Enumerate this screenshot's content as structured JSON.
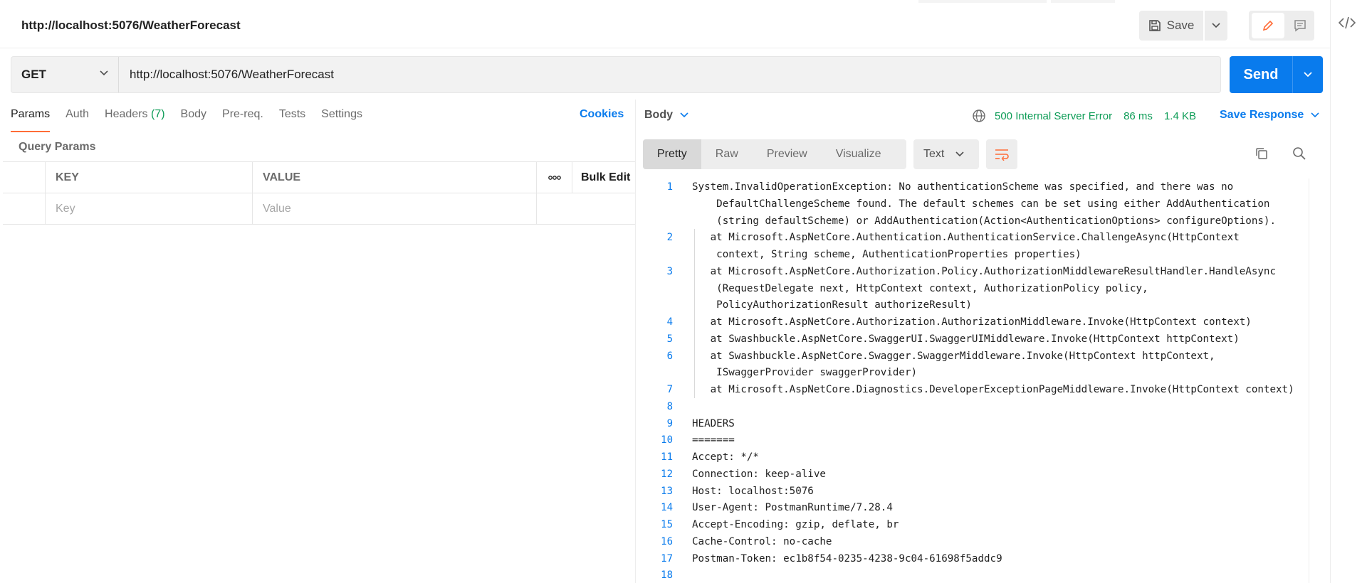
{
  "request": {
    "title": "http://localhost:5076/WeatherForecast",
    "method": "GET",
    "url": "http://localhost:5076/WeatherForecast",
    "save_label": "Save",
    "send_label": "Send"
  },
  "request_tabs": [
    {
      "label": "Params",
      "active": true
    },
    {
      "label": "Auth"
    },
    {
      "label": "Headers",
      "count": "(7)"
    },
    {
      "label": "Body"
    },
    {
      "label": "Pre-req."
    },
    {
      "label": "Tests"
    },
    {
      "label": "Settings"
    }
  ],
  "cookies_label": "Cookies",
  "query_params": {
    "label": "Query Params",
    "key_header": "KEY",
    "value_header": "VALUE",
    "more_label": "ooo",
    "bulk_edit_label": "Bulk Edit",
    "key_placeholder": "Key",
    "value_placeholder": "Value"
  },
  "response": {
    "body_label": "Body",
    "status": "500 Internal Server Error",
    "time": "86 ms",
    "size": "1.4 KB",
    "save_response_label": "Save Response",
    "view_tabs": [
      "Pretty",
      "Raw",
      "Preview",
      "Visualize"
    ],
    "active_view": "Pretty",
    "format": "Text"
  },
  "code_lines": [
    {
      "n": "1",
      "parts": [
        "System.InvalidOperationException: No authenticationScheme was specified, and there was no",
        "    DefaultChallengeScheme found. The default schemes can be set using either AddAuthentication",
        "    (string defaultScheme) or AddAuthentication(Action<AuthenticationOptions> configureOptions)."
      ]
    },
    {
      "n": "2",
      "parts": [
        "   at Microsoft.AspNetCore.Authentication.AuthenticationService.ChallengeAsync(HttpContext",
        "    context, String scheme, AuthenticationProperties properties)"
      ]
    },
    {
      "n": "3",
      "parts": [
        "   at Microsoft.AspNetCore.Authorization.Policy.AuthorizationMiddlewareResultHandler.HandleAsync",
        "    (RequestDelegate next, HttpContext context, AuthorizationPolicy policy,",
        "    PolicyAuthorizationResult authorizeResult)"
      ]
    },
    {
      "n": "4",
      "parts": [
        "   at Microsoft.AspNetCore.Authorization.AuthorizationMiddleware.Invoke(HttpContext context)"
      ]
    },
    {
      "n": "5",
      "parts": [
        "   at Swashbuckle.AspNetCore.SwaggerUI.SwaggerUIMiddleware.Invoke(HttpContext httpContext)"
      ]
    },
    {
      "n": "6",
      "parts": [
        "   at Swashbuckle.AspNetCore.Swagger.SwaggerMiddleware.Invoke(HttpContext httpContext,",
        "    ISwaggerProvider swaggerProvider)"
      ]
    },
    {
      "n": "7",
      "parts": [
        "   at Microsoft.AspNetCore.Diagnostics.DeveloperExceptionPageMiddleware.Invoke(HttpContext context)"
      ]
    },
    {
      "n": "8",
      "parts": [
        ""
      ]
    },
    {
      "n": "9",
      "parts": [
        "HEADERS"
      ]
    },
    {
      "n": "10",
      "parts": [
        "======="
      ]
    },
    {
      "n": "11",
      "parts": [
        "Accept: */*"
      ]
    },
    {
      "n": "12",
      "parts": [
        "Connection: keep-alive"
      ]
    },
    {
      "n": "13",
      "parts": [
        "Host: localhost:5076"
      ]
    },
    {
      "n": "14",
      "parts": [
        "User-Agent: PostmanRuntime/7.28.4"
      ]
    },
    {
      "n": "15",
      "parts": [
        "Accept-Encoding: gzip, deflate, br"
      ]
    },
    {
      "n": "16",
      "parts": [
        "Cache-Control: no-cache"
      ]
    },
    {
      "n": "17",
      "parts": [
        "Postman-Token: ec1b8f54-0235-4238-9c04-61698f5addc9"
      ]
    },
    {
      "n": "18",
      "parts": [
        ""
      ]
    }
  ],
  "colors": {
    "accent_blue": "#097bed",
    "status_green": "#0f9d58",
    "active_tab_orange": "#ff6c37"
  },
  "icons": [
    "save-icon",
    "chevron-down-icon",
    "pencil-icon",
    "comment-icon",
    "code-icon",
    "globe-icon",
    "wrap-lines-icon",
    "copy-icon",
    "search-icon"
  ]
}
